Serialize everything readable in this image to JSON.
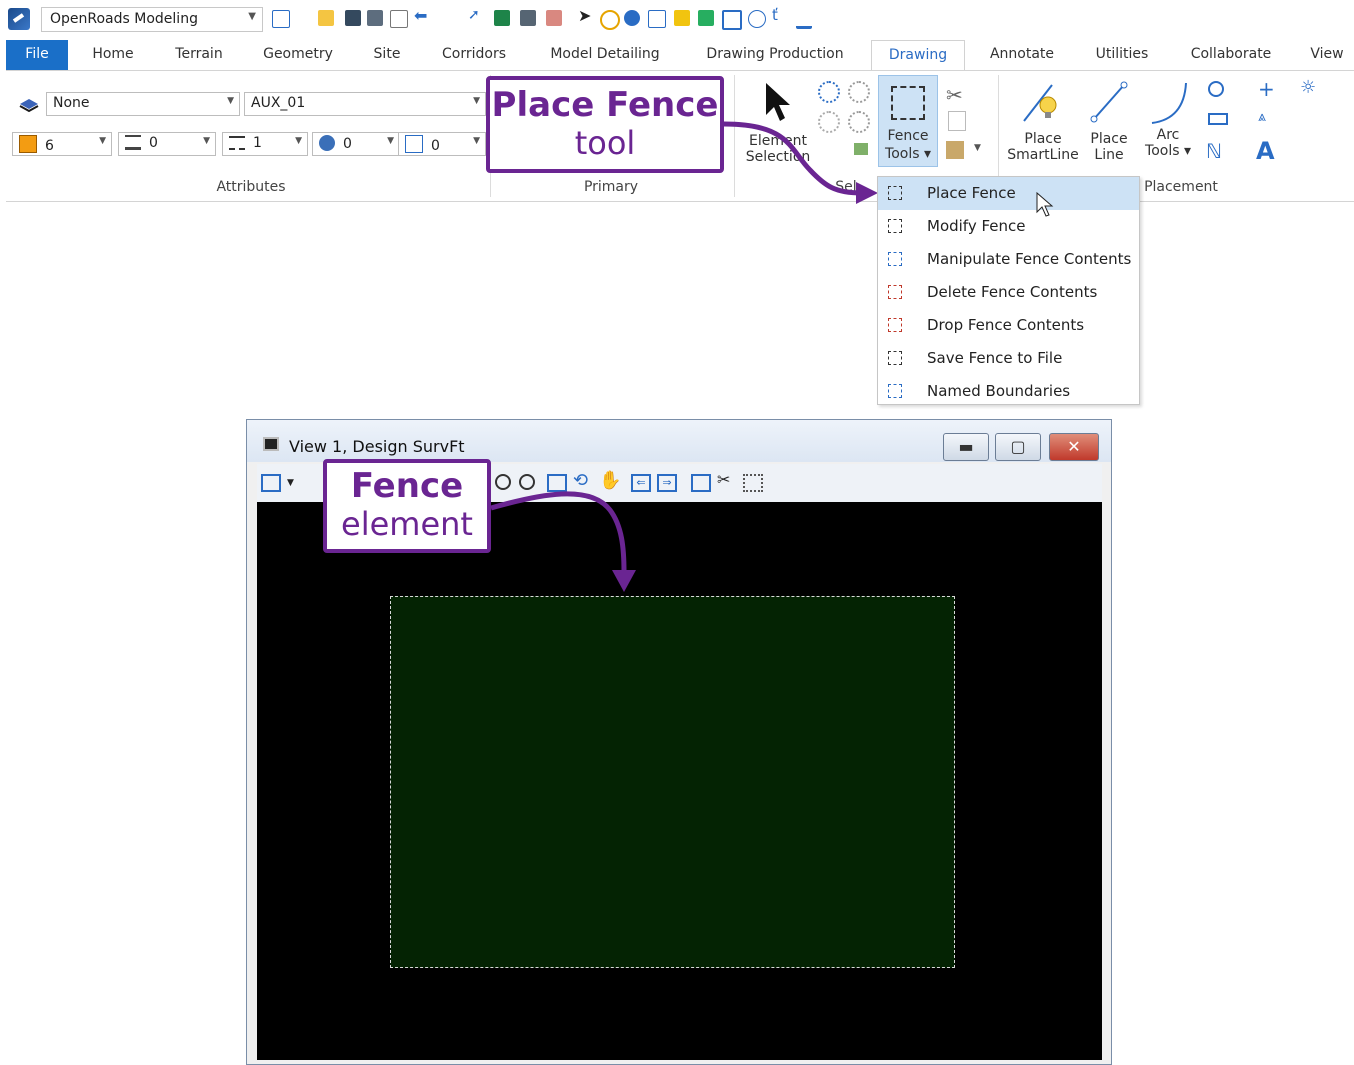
{
  "quick_access": {
    "workflow": "OpenRoads Modeling"
  },
  "tabs": [
    {
      "label": "File"
    },
    {
      "label": "Home"
    },
    {
      "label": "Terrain"
    },
    {
      "label": "Geometry"
    },
    {
      "label": "Site"
    },
    {
      "label": "Corridors"
    },
    {
      "label": "Model Detailing"
    },
    {
      "label": "Drawing Production"
    },
    {
      "label": "Drawing"
    },
    {
      "label": "Annotate"
    },
    {
      "label": "Utilities"
    },
    {
      "label": "Collaborate"
    },
    {
      "label": "View"
    }
  ],
  "active_tab": "Drawing",
  "attributes": {
    "level_display": "None",
    "level": "AUX_01",
    "color": "6",
    "weight": "0",
    "style": "1",
    "transparency": "0",
    "priority": "0",
    "group_label": "Attributes",
    "color_swatch": "#f39c12"
  },
  "primary": {
    "group_label": "Primary"
  },
  "selection": {
    "element_selection_label": "Element Selection",
    "group_label_partial": "Sel"
  },
  "fence_tools": {
    "label_line1": "Fence",
    "label_line2": "Tools ▾"
  },
  "placement": {
    "smartline_line1": "Place",
    "smartline_line2": "SmartLine",
    "line_line1": "Place",
    "line_line2": "Line",
    "arc_line1": "Arc",
    "arc_line2": "Tools ▾",
    "group_label": "Placement",
    "text_glyph": "A"
  },
  "callouts": {
    "place_fence_title": "Place Fence",
    "place_fence_sub": "tool",
    "fence_element_title": "Fence",
    "fence_element_sub": "element",
    "color": "#6a2592"
  },
  "fence_menu": {
    "items": [
      {
        "label": "Place Fence",
        "highlighted": true
      },
      {
        "label": "Modify Fence"
      },
      {
        "label": "Manipulate Fence Contents"
      },
      {
        "label": "Delete Fence Contents"
      },
      {
        "label": "Drop Fence Contents"
      },
      {
        "label": "Save Fence to File"
      },
      {
        "label": "Named Boundaries"
      }
    ]
  },
  "view_window": {
    "title": "View 1, Design SurvFt",
    "background": "#000000",
    "fence_fill": "#042303"
  }
}
